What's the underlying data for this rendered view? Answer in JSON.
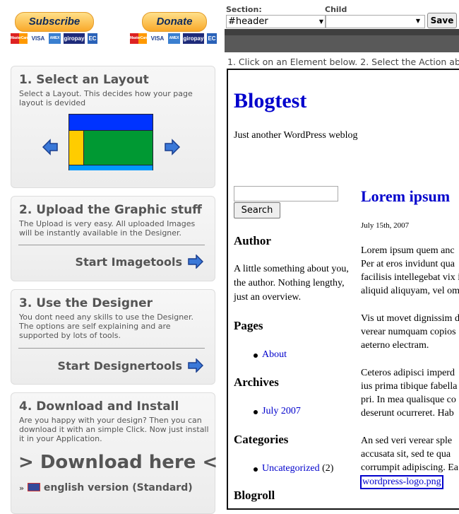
{
  "paypal": {
    "subscribe": "Subscribe",
    "donate": "Donate",
    "cards": [
      "MasterCard",
      "VISA",
      "AMEX",
      "giropay",
      "EC"
    ]
  },
  "toolbar": {
    "section_label": "Section:",
    "section_value": "#header",
    "child_label": "Child",
    "child_value": "",
    "save": "Save"
  },
  "instructions": "1. Click on an Element below. 2. Select the Action ab",
  "steps": [
    {
      "title": "1. Select an Layout",
      "desc": "Select a Layout. This decides how your page layout is devided"
    },
    {
      "title": "2. Upload the Graphic stuff",
      "desc": "The Upload is very easy. All uploaded Images will be instantly available in the Designer.",
      "action": "Start Imagetools"
    },
    {
      "title": "3. Use the Designer",
      "desc": "You dont need any skills to use the Designer. The options are self explaining and are supported by lots of tools.",
      "action": "Start Designertools"
    },
    {
      "title": "4. Download and Install",
      "desc": "Are you happy with your design? Then you can download it with an simple Click. Now just install it in your Application.",
      "action": "> Download here <",
      "version_prefix": "»",
      "version": "english version (Standard)"
    }
  ],
  "layout_colors": {
    "header": "#0033ff",
    "sidebar": "#ffcc00",
    "content": "#009933",
    "footer": "#0099ff"
  },
  "blog": {
    "title": "Blogtest",
    "tagline": "Just another WordPress weblog",
    "search_button": "Search",
    "search_value": "",
    "author_heading": "Author",
    "author_text": "A little something about you, the author. Nothing lengthy, just an overview.",
    "pages_heading": "Pages",
    "pages": [
      "About"
    ],
    "archives_heading": "Archives",
    "archives": [
      "July 2007"
    ],
    "categories_heading": "Categories",
    "categories": [
      {
        "name": "Uncategorized",
        "count": "(2)"
      }
    ],
    "blogroll_heading": "Blogroll",
    "post_title": "Lorem ipsum",
    "post_date": "July 15th, 2007",
    "post_lines": [
      "Lorem ipsum quem anc",
      "Per at eros invidunt qua",
      "facilisis intellegebat vix i",
      "aliquid aliquyam, vel om",
      "Vis ut movet dignissim d",
      "verear numquam copios",
      "aeterno electram.",
      "Ceteros adipisci imperd",
      "ius prima tibique fabella",
      "pri. In mea qualisque co",
      "deserunt ocurreret. Hab",
      "An sed veri verear sple",
      "accusata sit, sed te qua",
      "corrumpit adipiscing. Ea"
    ],
    "image_link": "wordpress-logo.png"
  }
}
